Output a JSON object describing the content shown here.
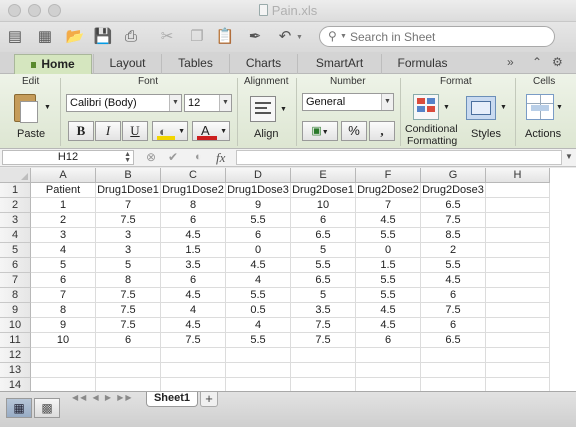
{
  "window": {
    "title": "Pain.xls"
  },
  "toolbar": {
    "icons": [
      "new-workbook-icon",
      "templates-icon",
      "open-icon",
      "save-icon",
      "print-icon",
      "cut-icon",
      "copy-icon",
      "paste-icon",
      "format-painter-icon"
    ],
    "search_placeholder": "Search in Sheet"
  },
  "ribbon_tabs": [
    {
      "label": "Home",
      "active": true
    },
    {
      "label": "Layout"
    },
    {
      "label": "Tables"
    },
    {
      "label": "Charts"
    },
    {
      "label": "SmartArt"
    },
    {
      "label": "Formulas"
    }
  ],
  "ribbon": {
    "edit": {
      "label": "Edit",
      "paste_label": "Paste"
    },
    "font": {
      "label": "Font",
      "font_name": "Calibri (Body)",
      "font_size": "12",
      "bold": "B",
      "italic": "I",
      "underline": "U",
      "fill_color": "#f2d500",
      "font_color": "#cc1f1f"
    },
    "alignment": {
      "label": "Alignment",
      "align_label": "Align"
    },
    "number": {
      "label": "Number",
      "format": "General",
      "percent": "%",
      "comma": ","
    },
    "format": {
      "label": "Format",
      "conditional_line1": "Conditional",
      "conditional_line2": "Formatting",
      "styles_label": "Styles"
    },
    "cells": {
      "label": "Cells",
      "actions_label": "Actions"
    }
  },
  "formula_bar": {
    "name_box": "H12",
    "fx": "fx",
    "formula": ""
  },
  "sheet": {
    "columns": [
      "A",
      "B",
      "C",
      "D",
      "E",
      "F",
      "G",
      "H"
    ],
    "row_numbers": [
      "1",
      "2",
      "3",
      "4",
      "5",
      "6",
      "7",
      "8",
      "9",
      "10",
      "11",
      "12",
      "13",
      "14"
    ],
    "rows": [
      [
        "Patient",
        "Drug1Dose1",
        "Drug1Dose2",
        "Drug1Dose3",
        "Drug2Dose1",
        "Drug2Dose2",
        "Drug2Dose3",
        ""
      ],
      [
        "1",
        "7",
        "8",
        "9",
        "10",
        "7",
        "6.5",
        ""
      ],
      [
        "2",
        "7.5",
        "6",
        "5.5",
        "6",
        "4.5",
        "7.5",
        ""
      ],
      [
        "3",
        "3",
        "4.5",
        "6",
        "6.5",
        "5.5",
        "8.5",
        ""
      ],
      [
        "4",
        "3",
        "1.5",
        "0",
        "5",
        "0",
        "2",
        ""
      ],
      [
        "5",
        "5",
        "3.5",
        "4.5",
        "5.5",
        "1.5",
        "5.5",
        ""
      ],
      [
        "6",
        "8",
        "6",
        "4",
        "6.5",
        "5.5",
        "4.5",
        ""
      ],
      [
        "7",
        "7.5",
        "4.5",
        "5.5",
        "5",
        "5.5",
        "6",
        ""
      ],
      [
        "8",
        "7.5",
        "4",
        "0.5",
        "3.5",
        "4.5",
        "7.5",
        ""
      ],
      [
        "9",
        "7.5",
        "4.5",
        "4",
        "7.5",
        "4.5",
        "6",
        ""
      ],
      [
        "10",
        "6",
        "7.5",
        "5.5",
        "7.5",
        "6",
        "6.5",
        ""
      ],
      [
        "",
        "",
        "",
        "",
        "",
        "",
        "",
        ""
      ],
      [
        "",
        "",
        "",
        "",
        "",
        "",
        "",
        ""
      ],
      [
        "",
        "",
        "",
        "",
        "",
        "",
        "",
        ""
      ]
    ]
  },
  "bottom": {
    "sheet_tab": "Sheet1",
    "add_sheet": "+"
  },
  "colors": {
    "ribbon_active_tab": "#d5e6bf",
    "ribbon_bg": "#e6ecdf",
    "grid_line": "#dcdcdc"
  }
}
